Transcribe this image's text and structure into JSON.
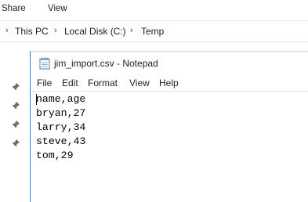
{
  "ribbon": {
    "tabs": [
      {
        "label": "Share"
      },
      {
        "label": "View"
      }
    ]
  },
  "address_bar": {
    "separator": "›",
    "crumbs": [
      "This PC",
      "Local Disk (C:)",
      "Temp"
    ]
  },
  "notepad": {
    "title": "jim_import.csv - Notepad",
    "menu": [
      "File",
      "Edit",
      "Format",
      "View",
      "Help"
    ],
    "lines": [
      "name,age",
      "bryan,27",
      "larry,34",
      "steve,43",
      "tom,29"
    ]
  },
  "colors": {
    "window_border": "#3e7bbf",
    "pin": "#6d6d6d",
    "text": "#1f1f1f"
  }
}
